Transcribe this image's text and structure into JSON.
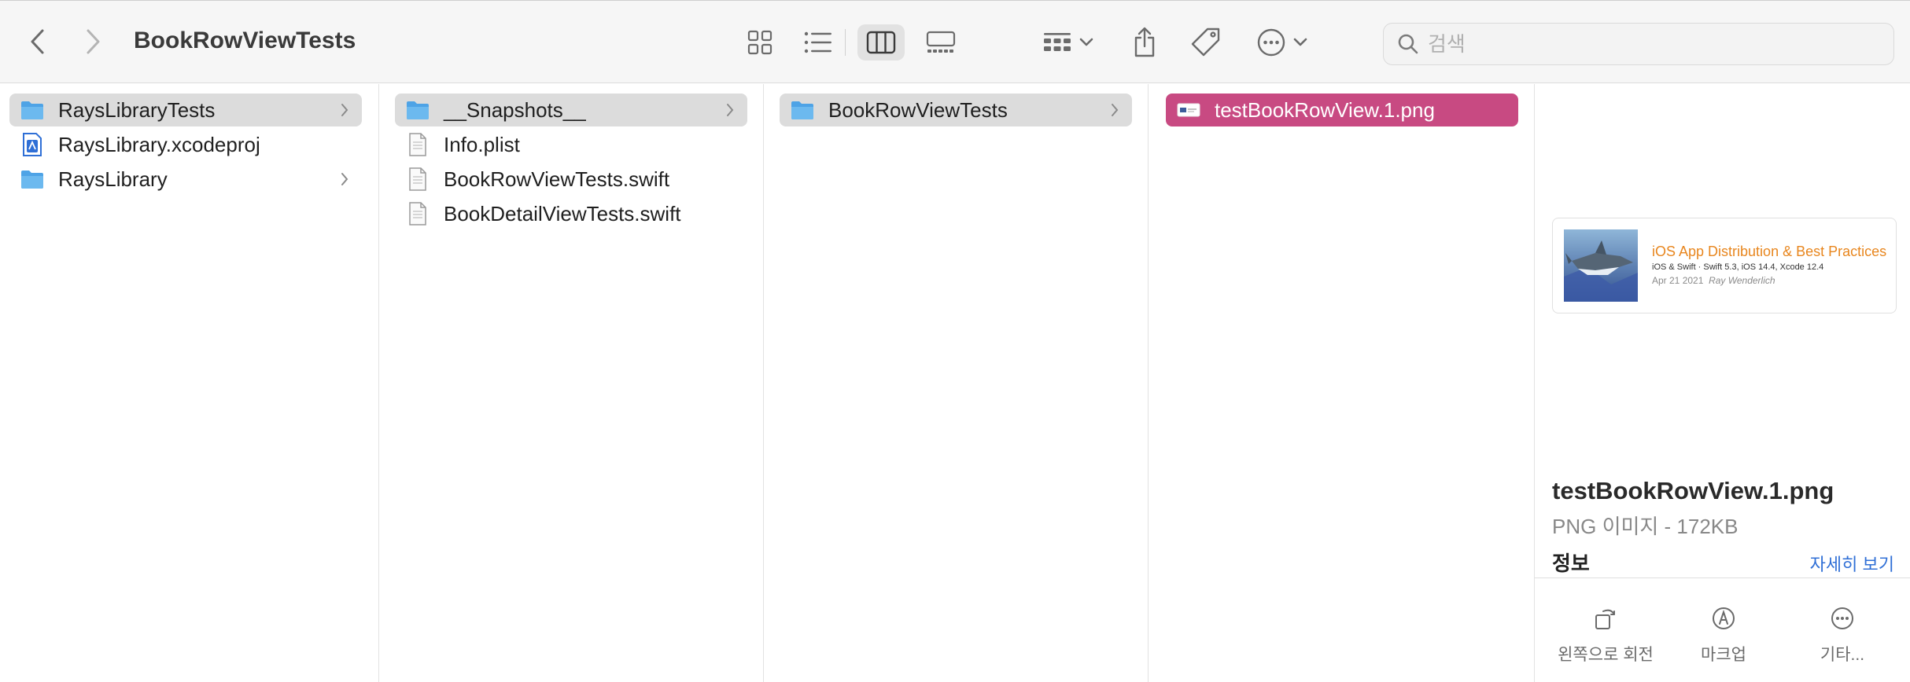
{
  "window": {
    "title": "BookRowViewTests"
  },
  "search": {
    "placeholder": "검색"
  },
  "columns": {
    "c1": [
      "RaysLibraryTests",
      "RaysLibrary.xcodeproj",
      "RaysLibrary"
    ],
    "c2": [
      "__Snapshots__",
      "Info.plist",
      "BookRowViewTests.swift",
      "BookDetailViewTests.swift"
    ],
    "c3": [
      "BookRowViewTests"
    ],
    "c4": [
      "testBookRowView.1.png"
    ]
  },
  "preview": {
    "thumbnail": {
      "title": "iOS App Distribution & Best Practices",
      "subtitle": "iOS & Swift · Swift 5.3, iOS 14.4, Xcode 12.4",
      "date": "Apr 21 2021",
      "author": "Ray Wenderlich"
    },
    "filename": "testBookRowView.1.png",
    "kind": "PNG 이미지 - 172KB",
    "info_label": "정보",
    "more_link": "자세히 보기",
    "actions": [
      "왼쪽으로 회전",
      "마크업",
      "기타..."
    ]
  },
  "colors": {
    "selection": "#c84a82",
    "folder": "#6cb3ea",
    "link": "#2f6fd6",
    "thumb_title": "#e8861e"
  }
}
